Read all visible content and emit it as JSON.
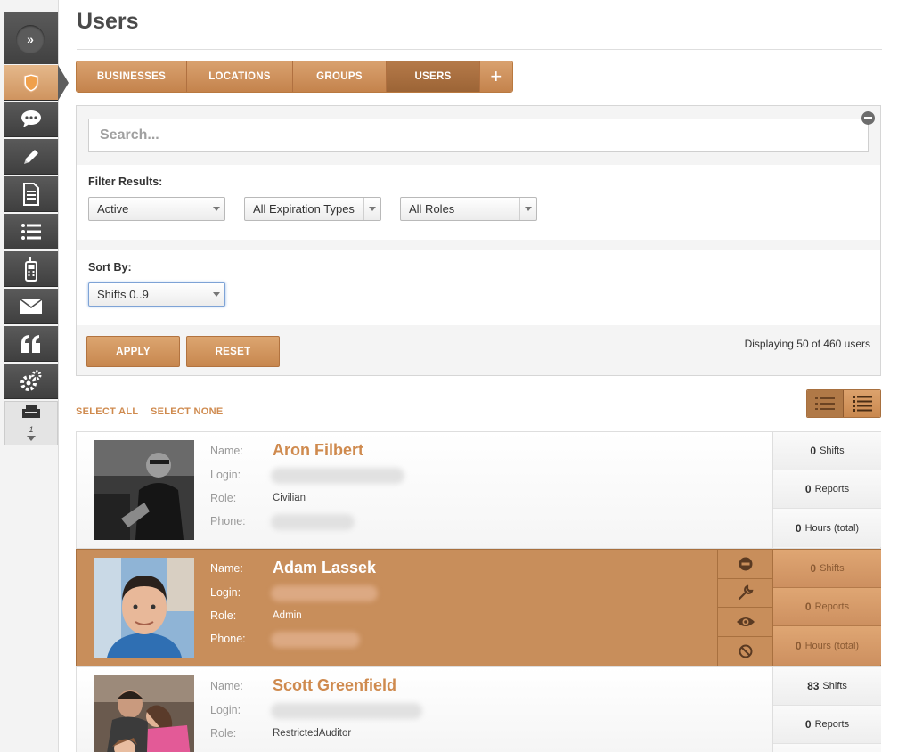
{
  "page": {
    "title": "Users"
  },
  "tabs": [
    {
      "label": "BUSINESSES"
    },
    {
      "label": "LOCATIONS"
    },
    {
      "label": "GROUPS"
    },
    {
      "label": "USERS",
      "active": true
    },
    {
      "label": "+"
    }
  ],
  "search": {
    "placeholder": "Search..."
  },
  "filter": {
    "label": "Filter Results:",
    "status": "Active",
    "expiration": "All Expiration Types",
    "roles": "All Roles"
  },
  "sort": {
    "label": "Sort By:",
    "value": "Shifts 0..9"
  },
  "buttons": {
    "apply": "APPLY",
    "reset": "RESET"
  },
  "display_count": "Displaying 50 of 460 users",
  "selection": {
    "select_all": "SELECT ALL",
    "select_none": "SELECT NONE"
  },
  "sidebar": {
    "toggle": "»",
    "page_number": "1"
  },
  "field_labels": {
    "name": "Name:",
    "login": "Login:",
    "role": "Role:",
    "phone": "Phone:"
  },
  "users": [
    {
      "name": "Aron Filbert",
      "role": "Civilian",
      "shifts": "0",
      "reports": "0",
      "hours": "0",
      "shifts_label": "Shifts",
      "reports_label": "Reports",
      "hours_label": "Hours (total)"
    },
    {
      "name": "Adam Lassek",
      "role": "Admin",
      "shifts": "0",
      "reports": "0",
      "hours": "0",
      "shifts_label": "Shifts",
      "reports_label": "Reports",
      "hours_label": "Hours (total)"
    },
    {
      "name": "Scott Greenfield",
      "role": "RestrictedAuditor",
      "shifts": "83",
      "reports": "0",
      "shifts_label": "Shifts",
      "reports_label": "Reports"
    }
  ],
  "colors": {
    "accent": "#c88e5b",
    "accent_text": "#cf8a4e",
    "sidebar": "#4a4a4a"
  }
}
